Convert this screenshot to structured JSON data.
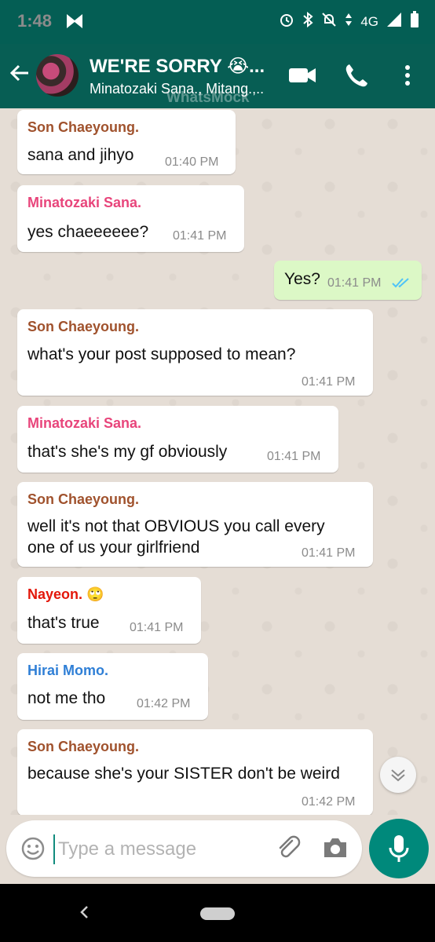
{
  "status_bar": {
    "time": "1:48",
    "network": "4G"
  },
  "header": {
    "title": "WE'RE SORRY 😭...",
    "subtitle": "Minatozaki Sana., Mitang.,..",
    "watermark": "WhatsMock"
  },
  "messages": [
    {
      "sender": "Son Chaeyoung.",
      "sender_color": "#a0522d",
      "text": "sana and jihyo",
      "time": "01:40 PM"
    },
    {
      "sender": "Minatozaki Sana.",
      "sender_color": "#e8457b",
      "text": "yes chaeeeeee?",
      "time": "01:41 PM"
    },
    {
      "text": "Yes?",
      "time": "01:41 PM",
      "outgoing": true
    },
    {
      "sender": "Son Chaeyoung.",
      "sender_color": "#a0522d",
      "text": "what's your post supposed to mean?",
      "time": "01:41 PM"
    },
    {
      "sender": "Minatozaki Sana.",
      "sender_color": "#e8457b",
      "text": "that's she's my gf obviously",
      "time": "01:41 PM"
    },
    {
      "sender": "Son Chaeyoung.",
      "sender_color": "#a0522d",
      "text_line1": "well it's not that OBVIOUS you call every",
      "text_line2": "one of us your girlfriend",
      "time": "01:41 PM"
    },
    {
      "sender": "Nayeon. 🙄",
      "sender_color": "#e3170a",
      "text": "that's true",
      "time": "01:41 PM"
    },
    {
      "sender": "Hirai Momo.",
      "sender_color": "#2f7fd6",
      "text": "not me tho",
      "time": "01:42 PM"
    },
    {
      "sender": "Son Chaeyoung.",
      "sender_color": "#a0522d",
      "text": "because she's your SISTER don't be weird",
      "time": "01:42 PM"
    }
  ],
  "composer": {
    "placeholder": "Type a message"
  },
  "colors": {
    "header": "#075e54",
    "status_bar": "#045e54",
    "accent": "#00897b",
    "read_ticks": "#4fc3f7"
  },
  "icons": [
    "back-arrow-icon",
    "video-call-icon",
    "phone-call-icon",
    "more-icon",
    "emoji-icon",
    "attach-icon",
    "camera-icon",
    "mic-icon",
    "chevron-down-icon"
  ]
}
